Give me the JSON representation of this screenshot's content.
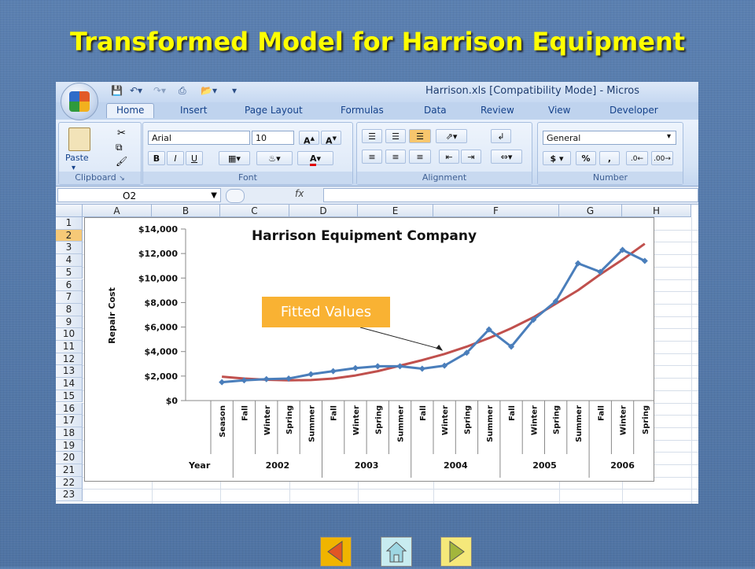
{
  "slide": {
    "title": "Transformed Model for Harrison Equipment",
    "callout": "Fitted Values",
    "colors": {
      "title": "#ffff00",
      "background": "#5478a8",
      "callout": "#f9b233"
    }
  },
  "excel": {
    "window_title": "Harrison.xls  [Compatibility Mode] - Micros",
    "tabs": [
      "Home",
      "Insert",
      "Page Layout",
      "Formulas",
      "Data",
      "Review",
      "View",
      "Developer"
    ],
    "active_tab": "Home",
    "groups": {
      "clipboard": "Clipboard",
      "font": "Font",
      "alignment": "Alignment",
      "number": "Number"
    },
    "paste_label": "Paste",
    "font_name": "Arial",
    "font_size": "10",
    "number_format": "General",
    "bold": "B",
    "italic": "I",
    "underline": "U",
    "currency": "$",
    "percent": "%",
    "comma": ",",
    "font_color_letter": "A",
    "grow_font": "A",
    "shrink_font": "A",
    "name_box": "O2",
    "fx": "fx",
    "columns": [
      "A",
      "B",
      "C",
      "D",
      "E",
      "F",
      "G",
      "H"
    ],
    "rows": [
      "1",
      "2",
      "3",
      "4",
      "5",
      "6",
      "7",
      "8",
      "9",
      "10",
      "11",
      "12",
      "13",
      "14",
      "15",
      "16",
      "17",
      "18",
      "19",
      "20",
      "21",
      "22",
      "23"
    ],
    "selected_row": "2"
  },
  "chart_data": {
    "type": "line",
    "title": "Harrison Equipment Company",
    "ylabel": "Repair Cost",
    "ylim": [
      0,
      14000
    ],
    "yticks": [
      "$0",
      "$2,000",
      "$4,000",
      "$6,000",
      "$8,000",
      "$10,000",
      "$12,000",
      "$14,000"
    ],
    "ytick_values": [
      0,
      2000,
      4000,
      6000,
      8000,
      10000,
      12000,
      14000
    ],
    "category_header_season": "Season",
    "category_header_year": "Year",
    "seasons": [
      "Fall",
      "Winter",
      "Spring",
      "Summer",
      "Fall",
      "Winter",
      "Spring",
      "Summer",
      "Fall",
      "Winter",
      "Spring",
      "Summer",
      "Fall",
      "Winter",
      "Spring",
      "Summer",
      "Fall",
      "Winter",
      "Spring"
    ],
    "years": [
      {
        "label": "2002",
        "count": 4
      },
      {
        "label": "2003",
        "count": 4
      },
      {
        "label": "2004",
        "count": 4
      },
      {
        "label": "2005",
        "count": 4
      },
      {
        "label": "2006",
        "count": 3
      }
    ],
    "series": [
      {
        "values": [
          1500,
          1650,
          1750,
          1800,
          2150,
          2400,
          2650,
          2800,
          2800,
          2600,
          2850,
          3900,
          5800,
          4400,
          6600,
          8100,
          11200,
          10500,
          12300,
          11400
        ],
        "color": "#4a7ebb"
      },
      {
        "values": [
          1950,
          1800,
          1700,
          1650,
          1680,
          1800,
          2050,
          2400,
          2850,
          3300,
          3800,
          4400,
          5100,
          5900,
          6800,
          7900,
          9000,
          10300,
          11500,
          12800
        ],
        "color": "#c0504d"
      }
    ],
    "grid": false
  }
}
